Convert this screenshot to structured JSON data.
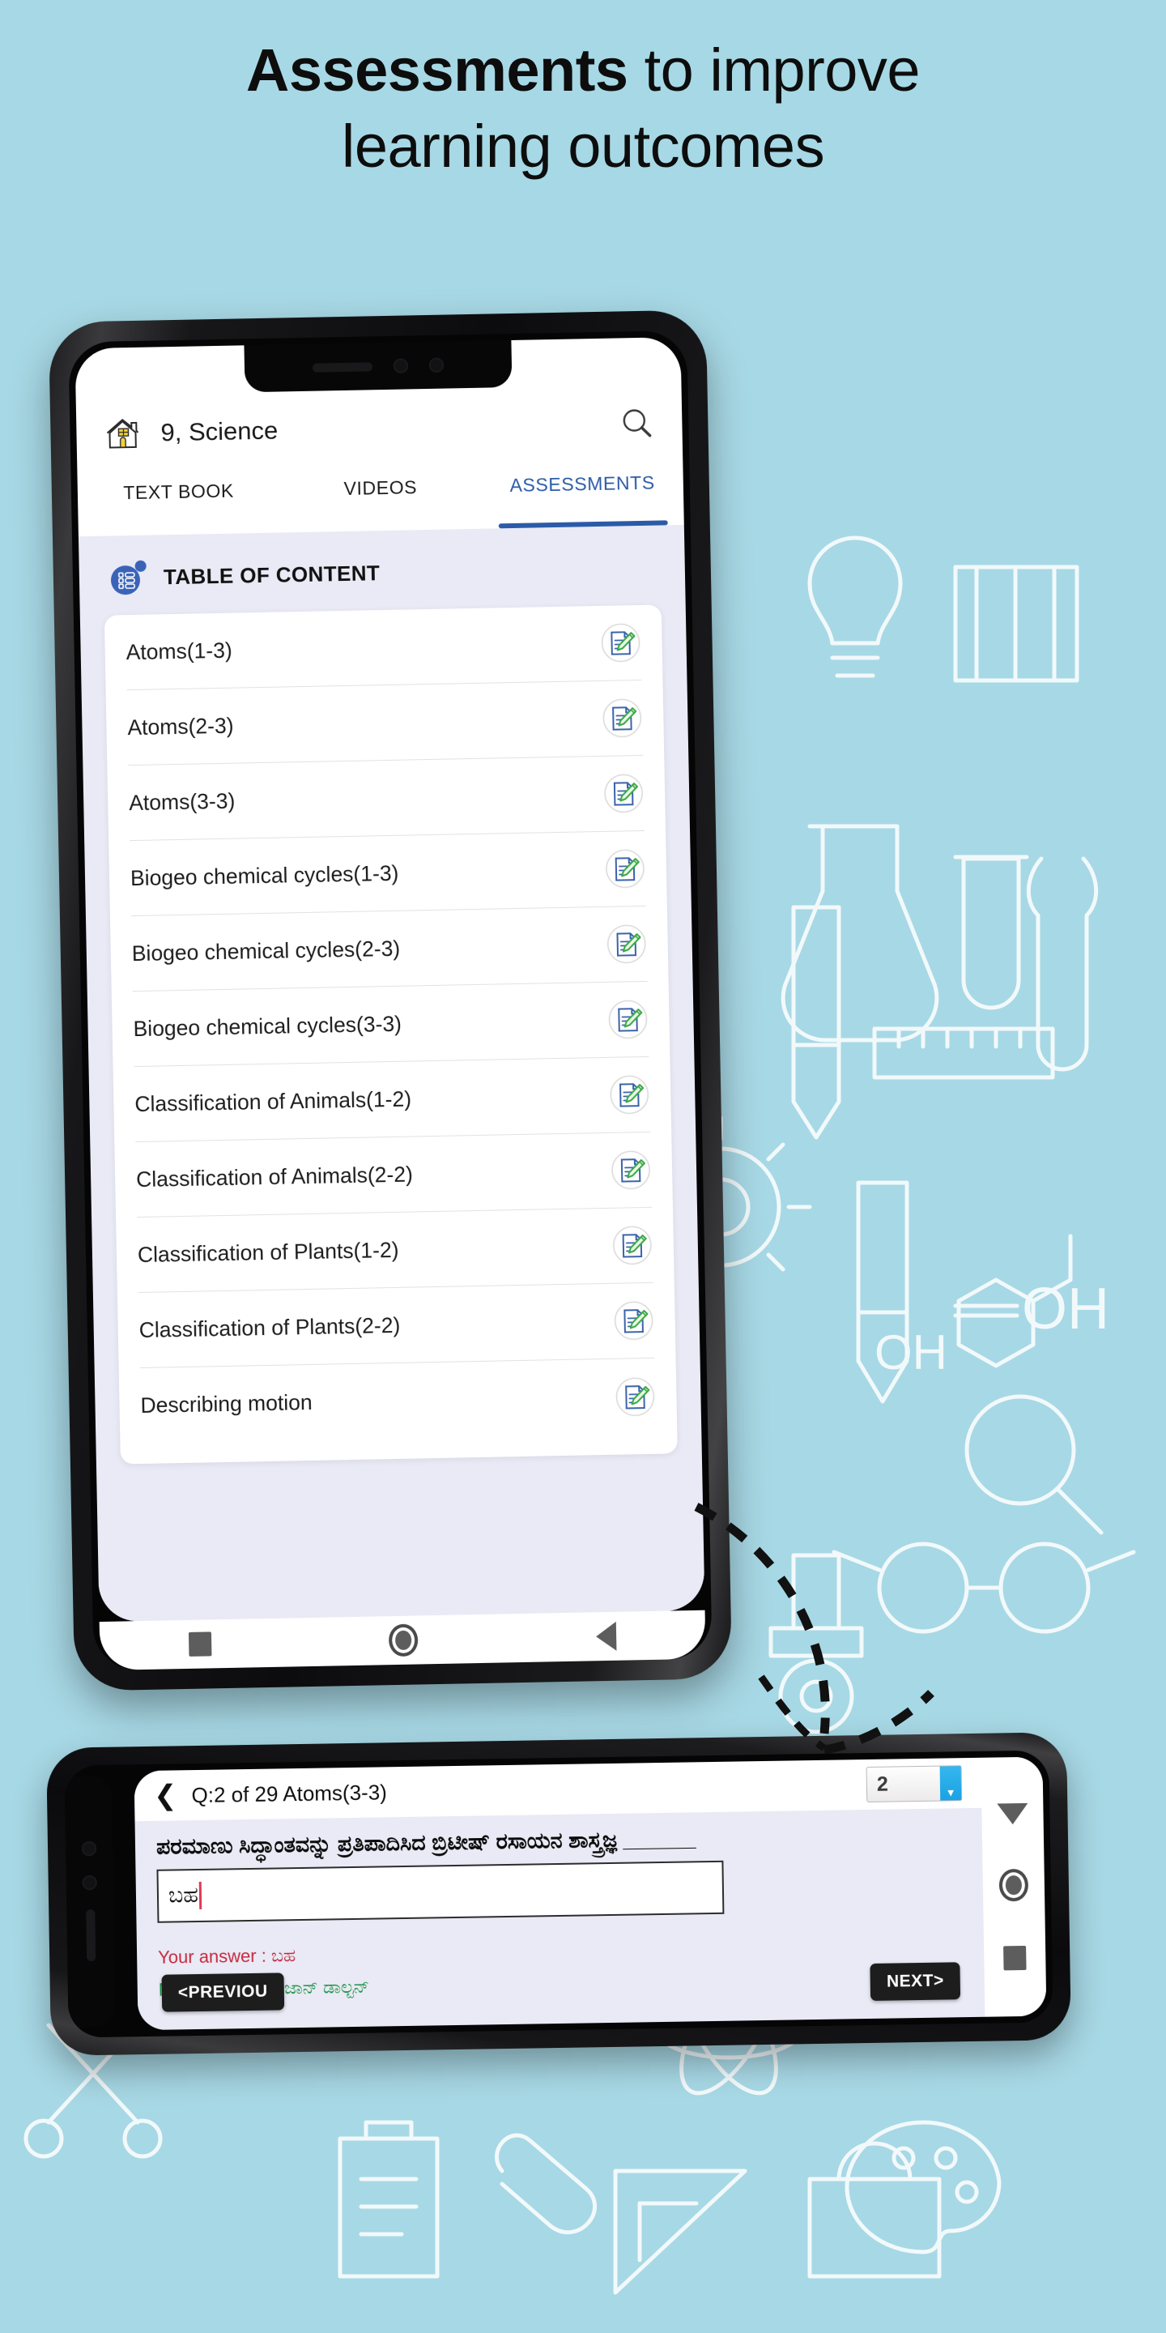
{
  "headline": {
    "bold": "Assessments",
    "rest": " to improve",
    "line2": "learning outcomes"
  },
  "colors": {
    "background": "#a7d8e5",
    "accent": "#2b5ba8",
    "answer_wrong": "#c62a3e",
    "answer_model": "#1f9447",
    "select_arrow": "#1ba2e2"
  },
  "top_phone": {
    "appbar": {
      "home_icon": "home-icon",
      "title": "9, Science",
      "search_icon": "search-icon"
    },
    "tabs": [
      {
        "label": "TEXT BOOK",
        "active": false
      },
      {
        "label": "VIDEOS",
        "active": false
      },
      {
        "label": "ASSESSMENTS",
        "active": true
      }
    ],
    "toc": {
      "icon": "list-circle-icon",
      "title": "TABLE OF CONTENT",
      "rows": [
        {
          "label": "Atoms(1-3)",
          "action_icon": "edit-note-icon"
        },
        {
          "label": "Atoms(2-3)",
          "action_icon": "edit-note-icon"
        },
        {
          "label": "Atoms(3-3)",
          "action_icon": "edit-note-icon"
        },
        {
          "label": "Biogeo chemical cycles(1-3)",
          "action_icon": "edit-note-icon"
        },
        {
          "label": "Biogeo chemical cycles(2-3)",
          "action_icon": "edit-note-icon"
        },
        {
          "label": "Biogeo chemical cycles(3-3)",
          "action_icon": "edit-note-icon"
        },
        {
          "label": "Classification of Animals(1-2)",
          "action_icon": "edit-note-icon"
        },
        {
          "label": "Classification of Animals(2-2)",
          "action_icon": "edit-note-icon"
        },
        {
          "label": "Classification of Plants(1-2)",
          "action_icon": "edit-note-icon"
        },
        {
          "label": "Classification of Plants(2-2)",
          "action_icon": "edit-note-icon"
        },
        {
          "label": "Describing motion",
          "action_icon": "edit-note-icon"
        }
      ]
    },
    "navbar": {
      "recents_icon": "square-icon",
      "home_icon": "circle-icon",
      "back_icon": "triangle-left-icon"
    }
  },
  "bottom_phone": {
    "qbar": {
      "back_icon": "chevron-left-icon",
      "title": "Q:2 of 29 Atoms(3-3)",
      "selector_value": "2",
      "selector_arrow_icon": "chevron-down-icon"
    },
    "question": "ಪರಮಾಣು ಸಿದ್ಧಾಂತವನ್ನು ಪ್ರತಿಪಾದಿಸಿದ ಬ್ರಿಟೀಷ್ ರಸಾಯನ ಶಾಸ್ತ್ರಜ್ಞ ______",
    "answer_input": "ಬಹ",
    "your_answer": "Your answer :  ಬಹ",
    "model_answer": "Model answer :  ಜಾನ್ ಡಾಲ್ಟನ್",
    "prev_button": "<PREVIOU",
    "next_button": "NEXT>",
    "navbar": {
      "back_icon": "triangle-down-icon",
      "home_icon": "circle-icon",
      "recents_icon": "square-icon"
    }
  }
}
